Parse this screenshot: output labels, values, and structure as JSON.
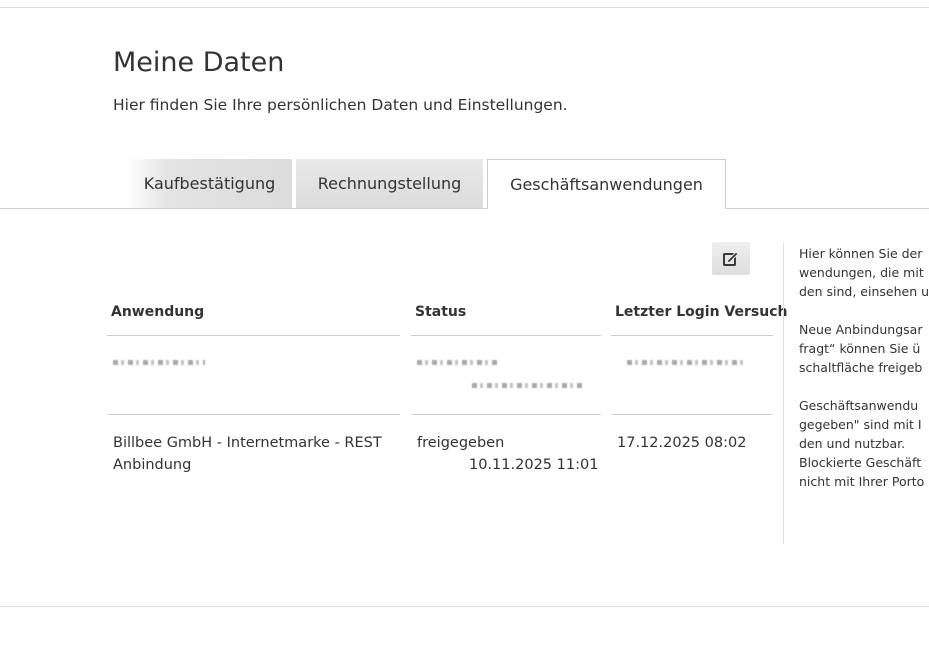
{
  "header": {
    "title": "Meine Daten",
    "subtitle": "Hier finden Sie Ihre persönlichen Daten und Einstellungen."
  },
  "tabs": [
    {
      "label": "Kaufbestätigung",
      "active": false
    },
    {
      "label": "Rechnungstellung",
      "active": false
    },
    {
      "label": "Geschäftsanwendungen",
      "active": true
    }
  ],
  "table": {
    "columns": [
      "Anwendung",
      "Status",
      "Letzter Login Versuch"
    ],
    "rows": [
      {
        "application": "Billbee GmbH - Internetmarke - REST Anbindung",
        "status": "freigegeben",
        "status_date": "10.11.2025 11:01",
        "last_login": "17.12.2025 08:02"
      }
    ]
  },
  "sidebar_info": {
    "paragraph_1": [
      "Hier können Sie der",
      "wendungen, die mit",
      "den sind, einsehen u"
    ],
    "paragraph_2": [
      "Neue Anbindungsar",
      "fragt“ können Sie ü",
      "schaltfläche freigeb"
    ],
    "paragraph_3": [
      "Geschäftsanwendu",
      "gegeben\" sind mit I",
      "den und nutzbar.",
      "Blockierte Geschäft",
      "nicht mit Ihrer Porto"
    ]
  },
  "icons": {
    "edit": "edit-icon"
  }
}
